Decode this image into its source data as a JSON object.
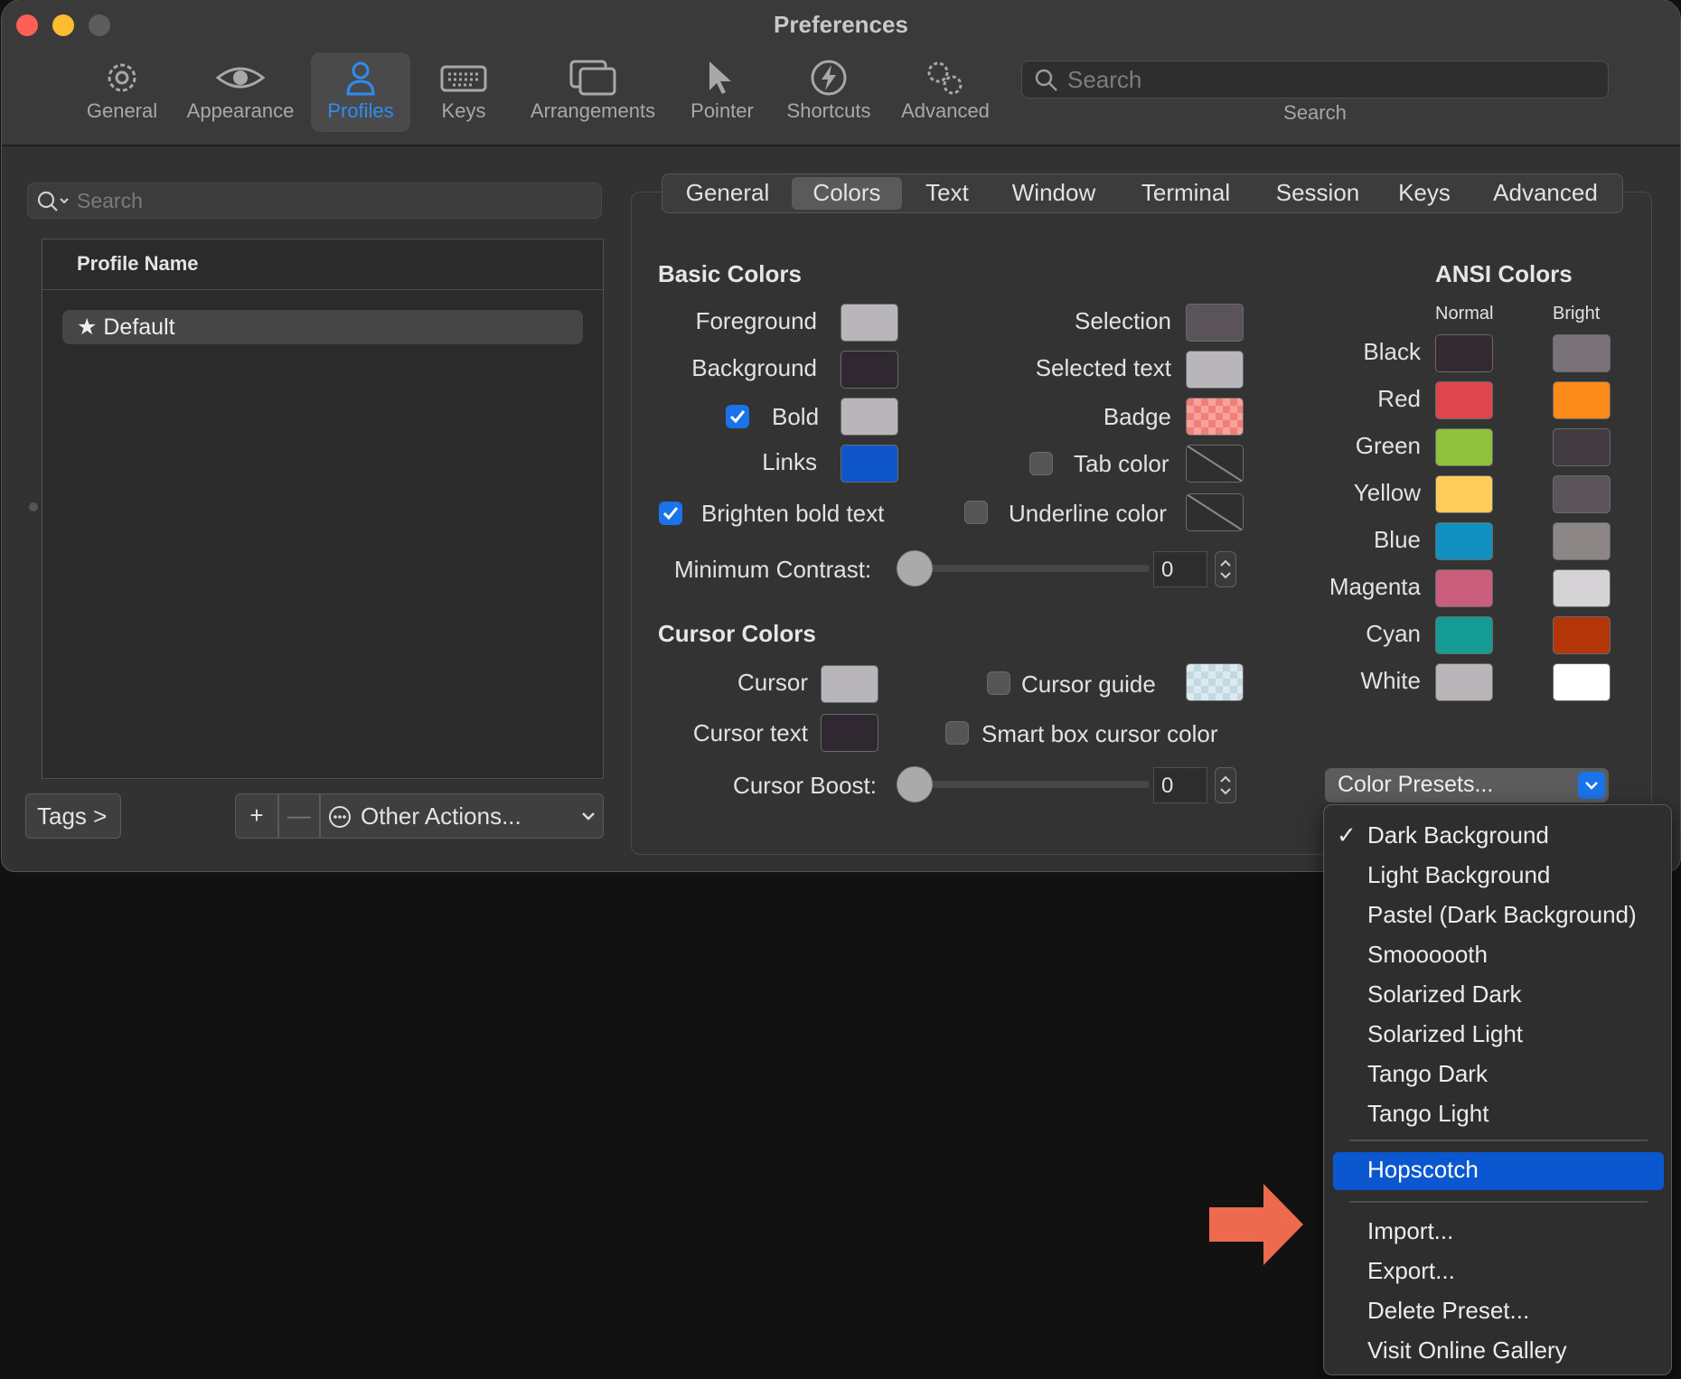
{
  "window": {
    "title": "Preferences"
  },
  "toolbar": {
    "items": [
      {
        "label": "General",
        "icon": "gear-icon"
      },
      {
        "label": "Appearance",
        "icon": "eye-icon"
      },
      {
        "label": "Profiles",
        "icon": "person-icon",
        "selected": true
      },
      {
        "label": "Keys",
        "icon": "keyboard-icon"
      },
      {
        "label": "Arrangements",
        "icon": "windows-icon"
      },
      {
        "label": "Pointer",
        "icon": "pointer-icon"
      },
      {
        "label": "Shortcuts",
        "icon": "bolt-icon"
      },
      {
        "label": "Advanced",
        "icon": "gears-icon"
      }
    ],
    "search_placeholder": "Search",
    "search_caption": "Search"
  },
  "profiles": {
    "search_placeholder": "Search",
    "column_header": "Profile Name",
    "rows": [
      {
        "name": "Default"
      }
    ],
    "tags_label": "Tags >",
    "add_label": "+",
    "remove_label": "—",
    "other_actions_label": "Other Actions..."
  },
  "tabs": [
    "General",
    "Colors",
    "Text",
    "Window",
    "Terminal",
    "Session",
    "Keys",
    "Advanced"
  ],
  "selected_tab": "Colors",
  "basic": {
    "title": "Basic Colors",
    "foreground": "Foreground",
    "background": "Background",
    "bold": "Bold",
    "links": "Links",
    "brighten": "Brighten bold text",
    "selection": "Selection",
    "selected_text": "Selected text",
    "badge": "Badge",
    "tab_color": "Tab color",
    "underline_color": "Underline color",
    "min_contrast": "Minimum Contrast:",
    "min_contrast_value": "0",
    "colors": {
      "foreground": "#b9b6bb",
      "background": "#2f2830",
      "bold": "#b9b6bb",
      "links": "#0e56c8",
      "selection": "#5a5359",
      "selected_text": "#b9b6bb",
      "badge": "#f07f7a"
    }
  },
  "cursor": {
    "title": "Cursor Colors",
    "cursor": "Cursor",
    "cursor_text": "Cursor text",
    "cursor_guide": "Cursor guide",
    "smart_box": "Smart box cursor color",
    "boost": "Cursor Boost:",
    "boost_value": "0",
    "colors": {
      "cursor": "#b9b6bb",
      "cursor_text": "#2f2830",
      "cursor_guide": "#dbe9f0"
    }
  },
  "ansi": {
    "title": "ANSI Colors",
    "normal_label": "Normal",
    "bright_label": "Bright",
    "rows": [
      {
        "name": "Black",
        "normal": "#322931",
        "bright": "#797379"
      },
      {
        "name": "Red",
        "normal": "#dd464c",
        "bright": "#fd8b19"
      },
      {
        "name": "Green",
        "normal": "#8fc13e",
        "bright": "#433b42"
      },
      {
        "name": "Yellow",
        "normal": "#fdcc59",
        "bright": "#5c545b"
      },
      {
        "name": "Blue",
        "normal": "#1290bf",
        "bright": "#8d8687"
      },
      {
        "name": "Magenta",
        "normal": "#c85e7c",
        "bright": "#d5d3d5"
      },
      {
        "name": "Cyan",
        "normal": "#149b93",
        "bright": "#b33508"
      },
      {
        "name": "White",
        "normal": "#b9b5b8",
        "bright": "#ffffff"
      }
    ]
  },
  "presets": {
    "button_label": "Color Presets...",
    "menu": {
      "group1": [
        {
          "label": "Dark Background",
          "check": "✓"
        },
        {
          "label": "Light Background",
          "check": ""
        },
        {
          "label": "Pastel (Dark Background)",
          "check": ""
        },
        {
          "label": "Smoooooth",
          "check": ""
        },
        {
          "label": "Solarized Dark",
          "check": ""
        },
        {
          "label": "Solarized Light",
          "check": ""
        },
        {
          "label": "Tango Dark",
          "check": ""
        },
        {
          "label": "Tango Light",
          "check": ""
        }
      ],
      "highlighted": "Hopscotch",
      "group3": [
        "Import...",
        "Export...",
        "Delete Preset...",
        "Visit Online Gallery"
      ]
    }
  },
  "colors": {
    "accent": "#2e8df5",
    "highlight": "#0b57d0",
    "arrow": "#ee6a4f"
  }
}
